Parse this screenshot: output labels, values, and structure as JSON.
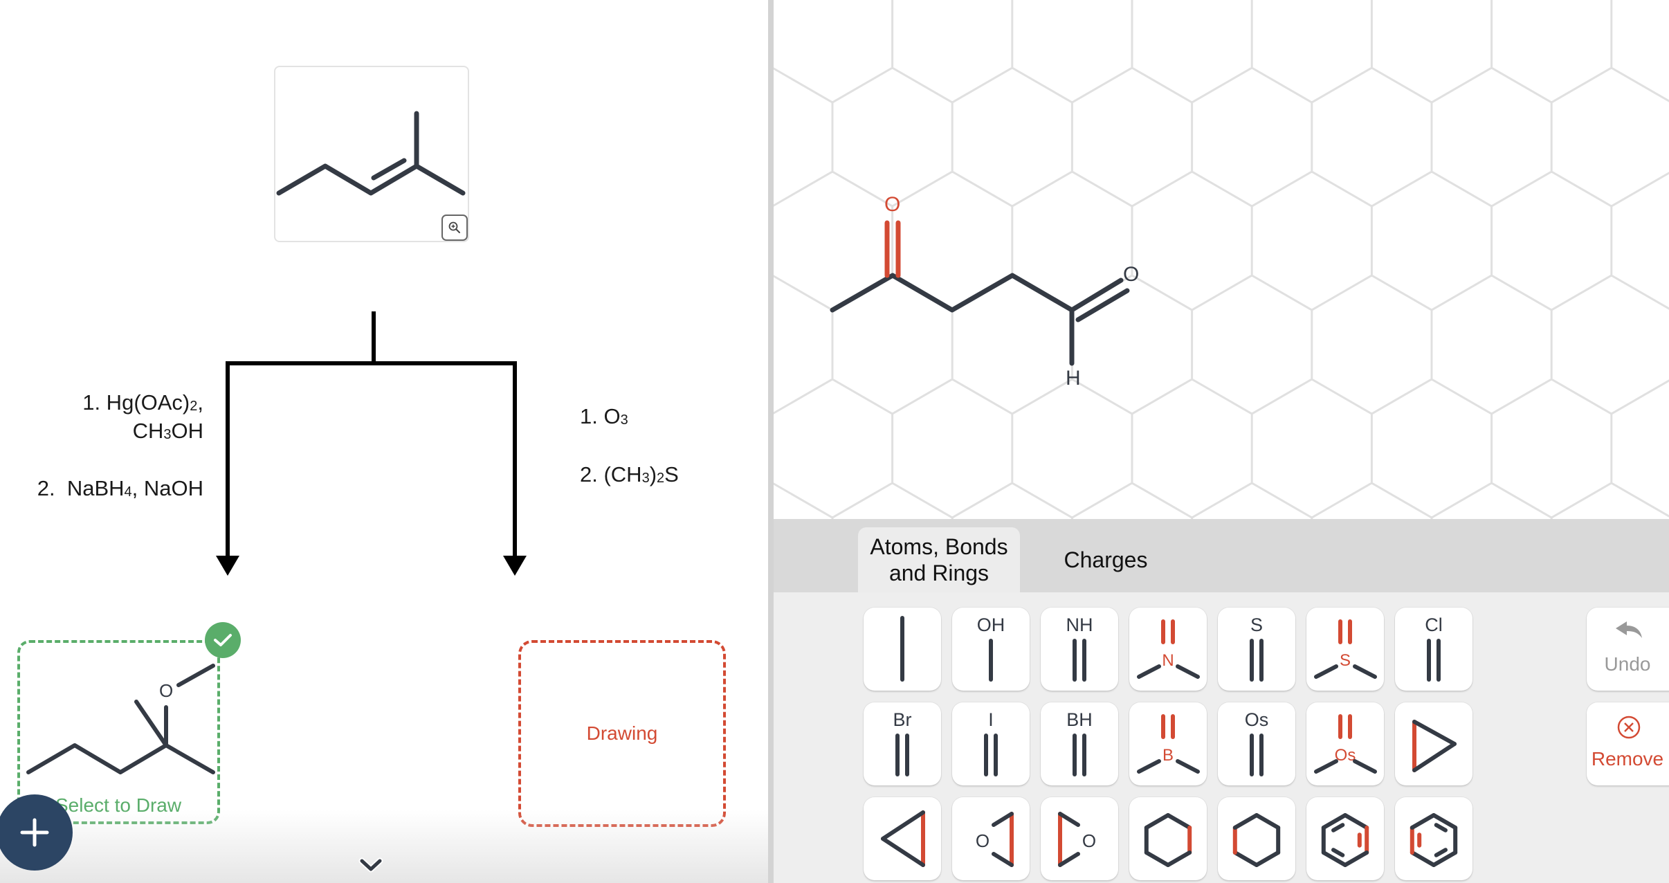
{
  "starting_material": {
    "name": "2-methyl-2-pentene",
    "zoom_icon": "zoom-in-icon"
  },
  "reactions": {
    "left": {
      "steps": [
        {
          "prefix": "1. Hg(OAc)",
          "sub": "2",
          "suffix": ","
        },
        {
          "prefix": "CH",
          "sub": "3",
          "suffix": "OH"
        },
        {
          "prefix": "2.  NaBH",
          "sub": "4",
          "suffix": ", NaOH"
        }
      ]
    },
    "right": {
      "steps": [
        {
          "prefix": "1. O",
          "sub": "3",
          "suffix": ""
        },
        {
          "prefix": "2. (CH",
          "sub": "3",
          "mid": ")",
          "sub2": "2",
          "suffix": "S"
        }
      ]
    }
  },
  "products": {
    "left": {
      "label": "Select to Draw",
      "status": "correct",
      "atom_label": "O"
    },
    "right": {
      "label": "Drawing",
      "status": "active"
    }
  },
  "fab": {
    "icon": "plus-icon"
  },
  "scroll": {
    "icon": "chevron-down-icon"
  },
  "canvas": {
    "atoms": {
      "ketone_O": "O",
      "aldehyde_O": "O",
      "aldehyde_H": "H"
    }
  },
  "toolbar": {
    "tabs": [
      {
        "label_line1": "Atoms, Bonds",
        "label_line2": "and Rings",
        "active": true
      },
      {
        "label": "Charges",
        "active": false
      }
    ],
    "tools": [
      {
        "name": "single-bond",
        "label": ""
      },
      {
        "name": "OH",
        "label": "OH"
      },
      {
        "name": "NH",
        "label": "NH"
      },
      {
        "name": "N-double",
        "label": "N"
      },
      {
        "name": "S",
        "label": "S"
      },
      {
        "name": "S-double",
        "label": "S"
      },
      {
        "name": "Cl",
        "label": "Cl"
      },
      {
        "name": "Br",
        "label": "Br"
      },
      {
        "name": "I",
        "label": "I"
      },
      {
        "name": "BH",
        "label": "BH"
      },
      {
        "name": "B-double",
        "label": "B"
      },
      {
        "name": "Os",
        "label": "Os"
      },
      {
        "name": "Os-double",
        "label": "Os"
      },
      {
        "name": "cyclopropane-left",
        "label": ""
      },
      {
        "name": "cyclopropane-right",
        "label": ""
      },
      {
        "name": "epoxide-left",
        "label": "O"
      },
      {
        "name": "epoxide-right",
        "label": "O"
      },
      {
        "name": "cyclohexane-right",
        "label": ""
      },
      {
        "name": "cyclohexane-left",
        "label": ""
      },
      {
        "name": "benzene-right",
        "label": ""
      },
      {
        "name": "benzene-left",
        "label": ""
      }
    ],
    "undo_label": "Undo",
    "remove_label": "Remove"
  },
  "colors": {
    "accent_red": "#d34a33",
    "success_green": "#5aad6a",
    "bond_dark": "#343a44",
    "fab_navy": "#2c4564",
    "grid_gray": "#e0e0e0"
  }
}
